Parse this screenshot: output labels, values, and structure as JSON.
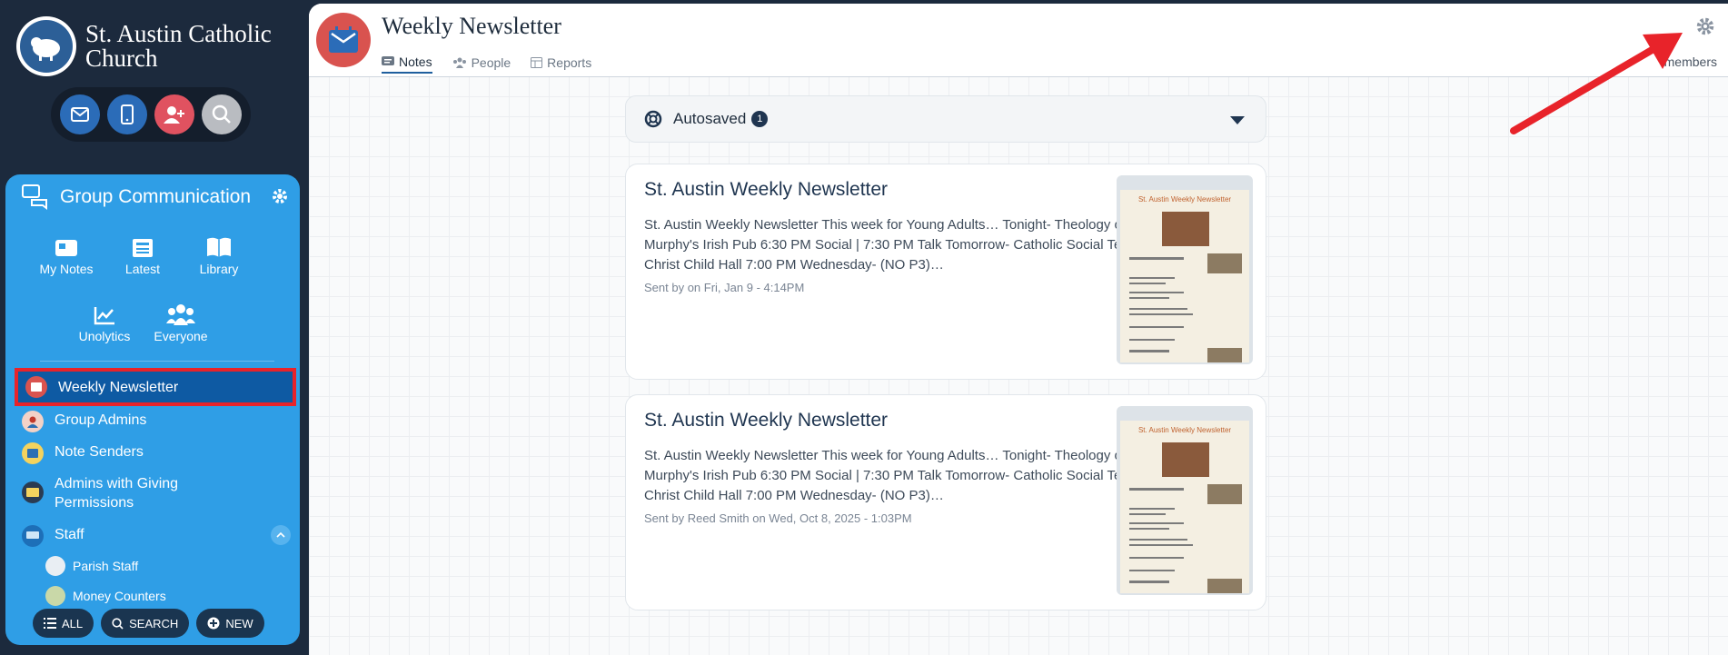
{
  "church": {
    "name": "St. Austin Catholic Church"
  },
  "sidebar": {
    "panel_title": "Group Communication",
    "shortcuts": [
      {
        "label": "My Notes"
      },
      {
        "label": "Latest"
      },
      {
        "label": "Library"
      },
      {
        "label": "Unolytics"
      },
      {
        "label": "Everyone"
      }
    ],
    "groups": [
      {
        "label": "Weekly Newsletter"
      },
      {
        "label": "Group Admins"
      },
      {
        "label": "Note Senders"
      },
      {
        "label": "Admins with Giving Permissions"
      },
      {
        "label": "Staff"
      }
    ],
    "subgroups": [
      {
        "label": "Parish Staff"
      },
      {
        "label": "Money Counters"
      }
    ],
    "bottom": {
      "all": "ALL",
      "search": "SEARCH",
      "new": "NEW"
    }
  },
  "main": {
    "title": "Weekly Newsletter",
    "tabs": [
      {
        "label": "Notes"
      },
      {
        "label": "People"
      },
      {
        "label": "Reports"
      }
    ],
    "members_link": "members",
    "autosaved": {
      "label": "Autosaved",
      "count": "1"
    },
    "notes": [
      {
        "title": "St. Austin Weekly Newsletter",
        "body": "St. Austin Weekly Newsletter This week for Young Adults… Tonight- Theology on Tap  @ Murphy's Irish Pub 6:30 PM Social | 7:30 PM Talk Tomorrow- Catholic Social Teaching Talk @ Christ Child Hall 7:00 PM Wednesday- (NO P3)…",
        "meta": "Sent by on Fri, Jan 9 - 4:14PM",
        "thumb_title": "St. Austin Weekly Newsletter"
      },
      {
        "title": "St. Austin Weekly Newsletter",
        "body": "St. Austin Weekly Newsletter This week for Young Adults… Tonight- Theology on Tap  @ Murphy's Irish Pub 6:30 PM Social | 7:30 PM Talk Tomorrow- Catholic Social Teaching Talk @ Christ Child Hall 7:00 PM Wednesday- (NO P3)…",
        "meta": "Sent by Reed Smith on Wed, Oct 8, 2025 - 1:03PM",
        "thumb_title": "St. Austin Weekly Newsletter"
      }
    ]
  },
  "colors": {
    "accent": "#2f9ee6",
    "dark": "#1c2a3d",
    "highlight": "#e8232a"
  }
}
